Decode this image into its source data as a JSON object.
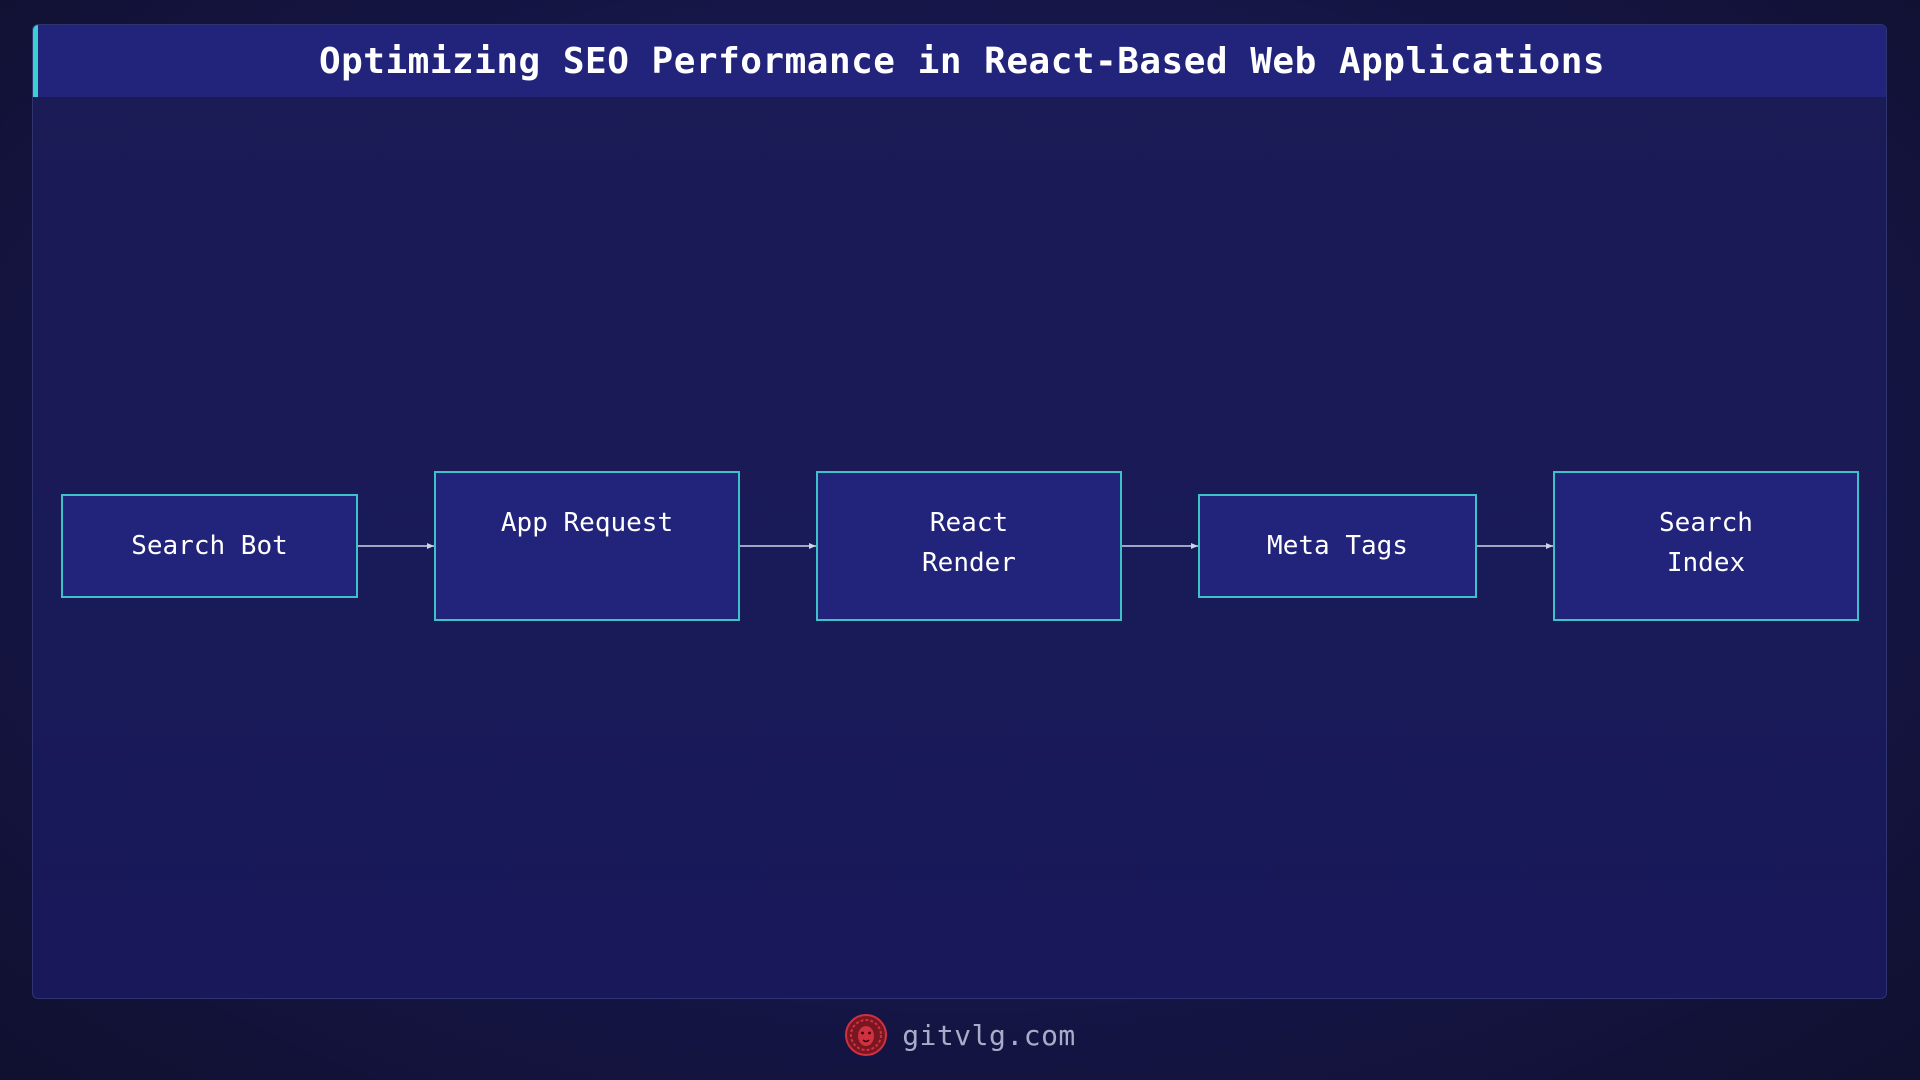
{
  "title": "Optimizing SEO Performance in React-Based Web Applications",
  "nodes": [
    {
      "id": "search-bot",
      "label": "Search Bot"
    },
    {
      "id": "app-request",
      "label": "App Request"
    },
    {
      "id": "react-render",
      "label": "React\nRender"
    },
    {
      "id": "meta-tags",
      "label": "Meta Tags"
    },
    {
      "id": "search-index",
      "label": "Search\nIndex"
    }
  ],
  "edges": [
    {
      "from": "search-bot",
      "to": "app-request"
    },
    {
      "from": "app-request",
      "to": "react-render"
    },
    {
      "from": "react-render",
      "to": "meta-tags"
    },
    {
      "from": "meta-tags",
      "to": "search-index"
    }
  ],
  "footer": {
    "logo_icon": "lion-head-logo-icon",
    "site": "gitvlg.com"
  },
  "colors": {
    "accent": "#3ad0cf",
    "node_fill": "#22237a",
    "node_border": "#3ec2c7",
    "logo": "#d0303f"
  }
}
